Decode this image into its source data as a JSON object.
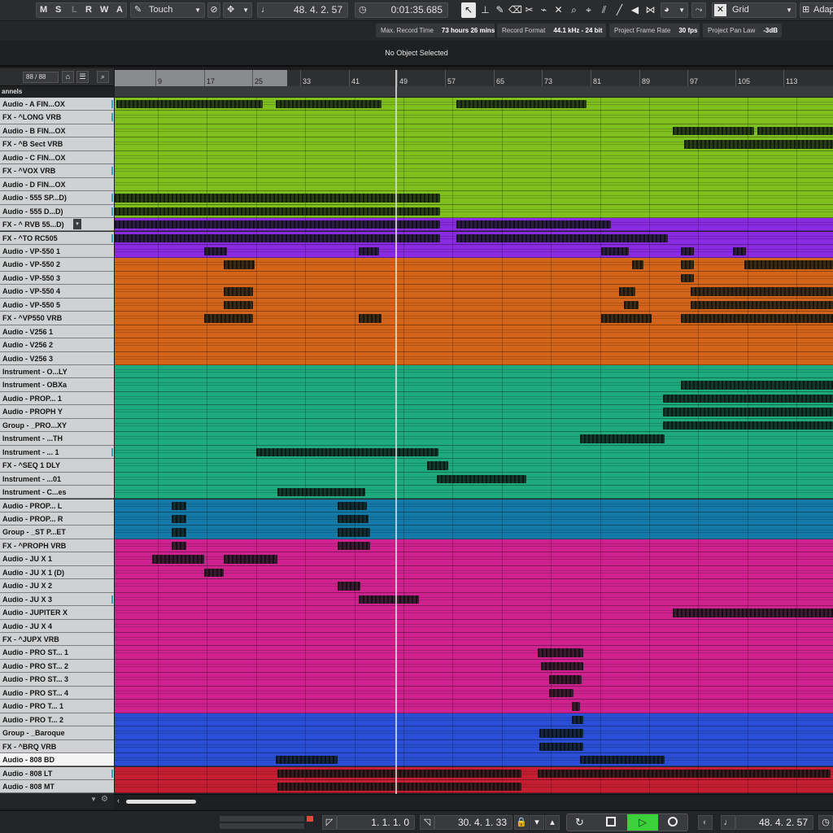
{
  "toolbar": {
    "msl": [
      "M",
      "S",
      "L",
      "R",
      "W",
      "A"
    ],
    "automation_mode": "Touch",
    "position": "48. 4. 2. 57",
    "time": "0:01:35.685",
    "snap_type": "Grid",
    "adapt_label": "Adap"
  },
  "infobar": [
    {
      "label": "Max. Record Time",
      "value": "73 hours 26 mins"
    },
    {
      "label": "Record Format",
      "value": "44.1 kHz - 24 bit"
    },
    {
      "label": "Project Frame Rate",
      "value": "30 fps"
    },
    {
      "label": "Project Pan Law",
      "value": "-3dB"
    }
  ],
  "event_line": "No Object Selected",
  "tracklist_header": {
    "count": "88 / 88",
    "channels_label": "annels"
  },
  "ruler": [
    "9",
    "17",
    "25",
    "33",
    "41",
    "49",
    "57",
    "65",
    "73",
    "81",
    "89",
    "97",
    "105",
    "113"
  ],
  "colors": {
    "lime": "#7fbf1e",
    "purple": "#8a2be2",
    "orange": "#d4641a",
    "teal": "#1faa7d",
    "blue": "#137aa8",
    "magenta": "#d0228f",
    "royal": "#2a4fd6",
    "red": "#c51e32"
  },
  "tracks": [
    {
      "name": "Audio - A FIN...OX",
      "color": "lime"
    },
    {
      "name": "FX - ^LONG VRB",
      "color": "lime"
    },
    {
      "name": "Audio - B FIN...OX",
      "color": "lime"
    },
    {
      "name": "FX - ^B Sect VRB",
      "color": "lime"
    },
    {
      "name": "Audio - C FIN...OX",
      "color": "lime"
    },
    {
      "name": "FX - ^VOX VRB",
      "color": "lime"
    },
    {
      "name": "Audio - D FIN...OX",
      "color": "lime"
    },
    {
      "name": "Audio - 555 SP...D)",
      "color": "lime"
    },
    {
      "name": "Audio - 555 D...D)",
      "color": "lime"
    },
    {
      "name": "FX - ^ RVB 55...D)",
      "color": "purple"
    },
    {
      "name": "FX - ^TO RC505",
      "color": "purple"
    },
    {
      "name": "Audio - VP-550  1",
      "color": "purple"
    },
    {
      "name": "Audio - VP-550  2",
      "color": "orange"
    },
    {
      "name": "Audio - VP-550  3",
      "color": "orange"
    },
    {
      "name": "Audio - VP-550  4",
      "color": "orange"
    },
    {
      "name": "Audio - VP-550 5",
      "color": "orange"
    },
    {
      "name": "FX - ^VP550 VRB",
      "color": "orange"
    },
    {
      "name": "Audio - V256  1",
      "color": "orange"
    },
    {
      "name": "Audio - V256  2",
      "color": "orange"
    },
    {
      "name": "Audio - V256  3",
      "color": "orange"
    },
    {
      "name": "Instrument - O...LY",
      "color": "teal"
    },
    {
      "name": "Instrument - OBXa",
      "color": "teal"
    },
    {
      "name": "Audio - PROP... 1",
      "color": "teal"
    },
    {
      "name": "Audio - PROPH Y",
      "color": "teal"
    },
    {
      "name": "Group - _PRO...XY",
      "color": "teal"
    },
    {
      "name": "Instrument - ...TH",
      "color": "teal"
    },
    {
      "name": "Instrument - ... 1",
      "color": "teal"
    },
    {
      "name": "FX - ^SEQ 1 DLY",
      "color": "teal"
    },
    {
      "name": "Instrument - ...01",
      "color": "teal"
    },
    {
      "name": "Instrument - C...es",
      "color": "teal"
    },
    {
      "name": "Audio - PROP... L",
      "color": "blue"
    },
    {
      "name": "Audio - PROP... R",
      "color": "blue"
    },
    {
      "name": "Group - _ST P...ET",
      "color": "blue"
    },
    {
      "name": "FX - ^PROPH VRB",
      "color": "magenta"
    },
    {
      "name": "Audio - JU X 1",
      "color": "magenta"
    },
    {
      "name": "Audio - JU X 1 (D)",
      "color": "magenta"
    },
    {
      "name": "Audio - JU X 2",
      "color": "magenta"
    },
    {
      "name": "Audio - JU X 3",
      "color": "magenta"
    },
    {
      "name": "Audio - JUPITER X",
      "color": "magenta"
    },
    {
      "name": "Audio - JU X 4",
      "color": "magenta"
    },
    {
      "name": "FX - ^JUPX VRB",
      "color": "magenta"
    },
    {
      "name": "Audio - PRO ST... 1",
      "color": "magenta"
    },
    {
      "name": "Audio - PRO ST... 2",
      "color": "magenta"
    },
    {
      "name": "Audio - PRO ST... 3",
      "color": "magenta"
    },
    {
      "name": "Audio - PRO ST... 4",
      "color": "magenta"
    },
    {
      "name": "Audio - PRO T... 1",
      "color": "magenta"
    },
    {
      "name": "Audio - PRO T... 2",
      "color": "royal"
    },
    {
      "name": "Group - _Baroque",
      "color": "royal"
    },
    {
      "name": "FX - ^BRQ VRB",
      "color": "royal"
    },
    {
      "name": "Audio - 808 BD",
      "color": "royal",
      "selected": true
    },
    {
      "name": "Audio - 808 LT",
      "color": "red"
    },
    {
      "name": "Audio - 808 MT",
      "color": "red"
    }
  ],
  "transport": {
    "left_locator": "1. 1. 1.   0",
    "right_locator": "30. 4. 1. 33",
    "position": "48. 4. 2. 57"
  }
}
